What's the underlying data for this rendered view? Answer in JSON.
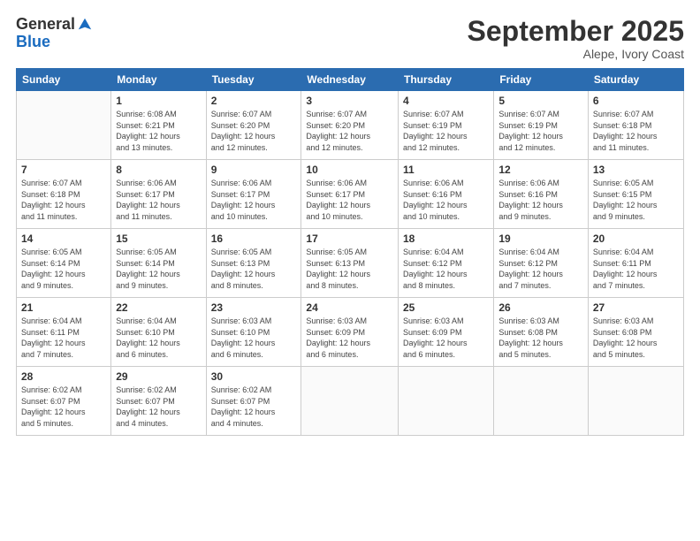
{
  "logo": {
    "general": "General",
    "blue": "Blue"
  },
  "title": "September 2025",
  "location": "Alepe, Ivory Coast",
  "days_header": [
    "Sunday",
    "Monday",
    "Tuesday",
    "Wednesday",
    "Thursday",
    "Friday",
    "Saturday"
  ],
  "weeks": [
    [
      {
        "day": "",
        "info": ""
      },
      {
        "day": "1",
        "info": "Sunrise: 6:08 AM\nSunset: 6:21 PM\nDaylight: 12 hours\nand 13 minutes."
      },
      {
        "day": "2",
        "info": "Sunrise: 6:07 AM\nSunset: 6:20 PM\nDaylight: 12 hours\nand 12 minutes."
      },
      {
        "day": "3",
        "info": "Sunrise: 6:07 AM\nSunset: 6:20 PM\nDaylight: 12 hours\nand 12 minutes."
      },
      {
        "day": "4",
        "info": "Sunrise: 6:07 AM\nSunset: 6:19 PM\nDaylight: 12 hours\nand 12 minutes."
      },
      {
        "day": "5",
        "info": "Sunrise: 6:07 AM\nSunset: 6:19 PM\nDaylight: 12 hours\nand 12 minutes."
      },
      {
        "day": "6",
        "info": "Sunrise: 6:07 AM\nSunset: 6:18 PM\nDaylight: 12 hours\nand 11 minutes."
      }
    ],
    [
      {
        "day": "7",
        "info": "Sunrise: 6:07 AM\nSunset: 6:18 PM\nDaylight: 12 hours\nand 11 minutes."
      },
      {
        "day": "8",
        "info": "Sunrise: 6:06 AM\nSunset: 6:17 PM\nDaylight: 12 hours\nand 11 minutes."
      },
      {
        "day": "9",
        "info": "Sunrise: 6:06 AM\nSunset: 6:17 PM\nDaylight: 12 hours\nand 10 minutes."
      },
      {
        "day": "10",
        "info": "Sunrise: 6:06 AM\nSunset: 6:17 PM\nDaylight: 12 hours\nand 10 minutes."
      },
      {
        "day": "11",
        "info": "Sunrise: 6:06 AM\nSunset: 6:16 PM\nDaylight: 12 hours\nand 10 minutes."
      },
      {
        "day": "12",
        "info": "Sunrise: 6:06 AM\nSunset: 6:16 PM\nDaylight: 12 hours\nand 9 minutes."
      },
      {
        "day": "13",
        "info": "Sunrise: 6:05 AM\nSunset: 6:15 PM\nDaylight: 12 hours\nand 9 minutes."
      }
    ],
    [
      {
        "day": "14",
        "info": "Sunrise: 6:05 AM\nSunset: 6:14 PM\nDaylight: 12 hours\nand 9 minutes."
      },
      {
        "day": "15",
        "info": "Sunrise: 6:05 AM\nSunset: 6:14 PM\nDaylight: 12 hours\nand 9 minutes."
      },
      {
        "day": "16",
        "info": "Sunrise: 6:05 AM\nSunset: 6:13 PM\nDaylight: 12 hours\nand 8 minutes."
      },
      {
        "day": "17",
        "info": "Sunrise: 6:05 AM\nSunset: 6:13 PM\nDaylight: 12 hours\nand 8 minutes."
      },
      {
        "day": "18",
        "info": "Sunrise: 6:04 AM\nSunset: 6:12 PM\nDaylight: 12 hours\nand 8 minutes."
      },
      {
        "day": "19",
        "info": "Sunrise: 6:04 AM\nSunset: 6:12 PM\nDaylight: 12 hours\nand 7 minutes."
      },
      {
        "day": "20",
        "info": "Sunrise: 6:04 AM\nSunset: 6:11 PM\nDaylight: 12 hours\nand 7 minutes."
      }
    ],
    [
      {
        "day": "21",
        "info": "Sunrise: 6:04 AM\nSunset: 6:11 PM\nDaylight: 12 hours\nand 7 minutes."
      },
      {
        "day": "22",
        "info": "Sunrise: 6:04 AM\nSunset: 6:10 PM\nDaylight: 12 hours\nand 6 minutes."
      },
      {
        "day": "23",
        "info": "Sunrise: 6:03 AM\nSunset: 6:10 PM\nDaylight: 12 hours\nand 6 minutes."
      },
      {
        "day": "24",
        "info": "Sunrise: 6:03 AM\nSunset: 6:09 PM\nDaylight: 12 hours\nand 6 minutes."
      },
      {
        "day": "25",
        "info": "Sunrise: 6:03 AM\nSunset: 6:09 PM\nDaylight: 12 hours\nand 6 minutes."
      },
      {
        "day": "26",
        "info": "Sunrise: 6:03 AM\nSunset: 6:08 PM\nDaylight: 12 hours\nand 5 minutes."
      },
      {
        "day": "27",
        "info": "Sunrise: 6:03 AM\nSunset: 6:08 PM\nDaylight: 12 hours\nand 5 minutes."
      }
    ],
    [
      {
        "day": "28",
        "info": "Sunrise: 6:02 AM\nSunset: 6:07 PM\nDaylight: 12 hours\nand 5 minutes."
      },
      {
        "day": "29",
        "info": "Sunrise: 6:02 AM\nSunset: 6:07 PM\nDaylight: 12 hours\nand 4 minutes."
      },
      {
        "day": "30",
        "info": "Sunrise: 6:02 AM\nSunset: 6:07 PM\nDaylight: 12 hours\nand 4 minutes."
      },
      {
        "day": "",
        "info": ""
      },
      {
        "day": "",
        "info": ""
      },
      {
        "day": "",
        "info": ""
      },
      {
        "day": "",
        "info": ""
      }
    ]
  ]
}
